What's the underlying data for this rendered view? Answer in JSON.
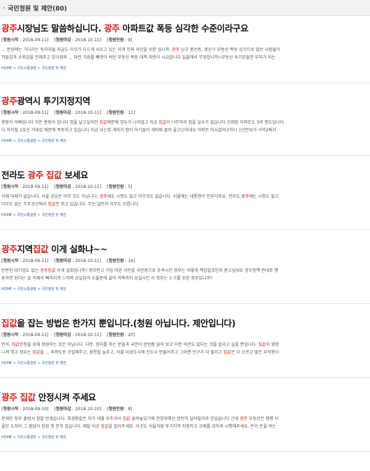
{
  "section": {
    "bullet": "·",
    "title": "국민청원 및 제안(80)"
  },
  "crumb_parts": [
    "HOME",
    "국민소통광장",
    "국민청원 및 제안"
  ],
  "posts": [
    {
      "title_parts": [
        {
          "t": "광주",
          "hl": true
        },
        {
          "t": "시장님도 말씀하십니다. ",
          "hl": false
        },
        {
          "t": "광주",
          "hl": true
        },
        {
          "t": " 아파트값 폭등 심각한 수준이라구요",
          "hl": false
        }
      ],
      "start_label": "청원시작",
      "start_date": "2018-09-11",
      "end_label": "청원마감",
      "end_date": "2018-10-11",
      "count_label": "청원인원",
      "count": "9",
      "lines": [
        [
          {
            "t": "... 문장에는 기다리는 투자자들 지금도 아무가 다드게 사오고 있는 이게 진짜 서민을 위한 입니까. ",
            "hl": false
          },
          {
            "t": "광주",
            "hl": true
          },
          {
            "t": " 남구 봉선동, 광산구 부동산 폭등 심각으로 많은 사람들이",
            "hl": false
          }
        ],
        [
          {
            "t": "허탈감과 소외감을 언제주고 양극화와 ... 마련 기회를 빼앗아 버린 부동산 폭등 대책 마련이 시급합니다 일을해서 무엇합니까!!부동산 투기꾼들만 부자가 되는",
            "hl": false
          }
        ]
      ]
    },
    {
      "title_parts": [
        {
          "t": "광주",
          "hl": true
        },
        {
          "t": "광역시 투기지정지역",
          "hl": false
        }
      ],
      "start_label": "청원시작",
      "start_date": "2018-09-11",
      "end_label": "청원마감",
      "end_date": "2018-10-11",
      "count_label": "청원인원",
      "count": "11",
      "lines": [
        [
          {
            "t": "봉동이 아빠입니다 이돈 봉동이 입니다 땅을 날고싶지만 ",
            "hl": false
          },
          {
            "t": "집값",
            "hl": true
          },
          {
            "t": "때문에 엄두가 나지않고 지금 ",
            "hl": false
          },
          {
            "t": "집값",
            "hl": true
          },
          {
            "t": "이 너무하여 집을 살수가 없습니다 오래된 아파트도 3억 평도입니다",
            "hl": false
          }
        ],
        [
          {
            "t": "다 지하철 2호선 기대감 때문에 폭등하고 있습니다 지금 사는집 개미가 땀아 아기들이 개미에 몰려 울고난리네요 아파트 이사갈려고하니 1년전보가 거의2배가",
            "hl": false
          }
        ]
      ]
    },
    {
      "title_parts": [
        {
          "t": "전라도 ",
          "hl": false
        },
        {
          "t": "광주 집값",
          "hl": true
        },
        {
          "t": " 보세요",
          "hl": false
        }
      ],
      "start_label": "청원시작",
      "start_date": "2018-09-11",
      "end_label": "청원마감",
      "end_date": "2018-10-11",
      "count_label": "청원인원",
      "count": "5",
      "lines": [
        [
          {
            "t": "이제 미래가 없습니다. 서울 강남은 아무 것도 아닙니다. ",
            "hl": false
          },
          {
            "t": "광주",
            "hl": true
          },
          {
            "t": "에도 시청도 없고 아무것도 없습니다. 서울에는 대통령이 안부이지요. 전라도 ",
            "hl": false
          },
          {
            "t": "광주",
            "hl": true
          },
          {
            "t": "에는 시청도 없고",
            "hl": false
          }
        ],
        [
          {
            "t": "아무도 없는 무주공산에서 ",
            "hl": false
          },
          {
            "t": "집값",
            "hl": true
          },
          {
            "t": "만 뛰고 있습니다. 무슨 일인지 아무도 모릅니다.",
            "hl": false
          }
        ]
      ]
    },
    {
      "title_parts": [
        {
          "t": "광주",
          "hl": true
        },
        {
          "t": "지역",
          "hl": false
        },
        {
          "t": "집값",
          "hl": true
        },
        {
          "t": " 이게 실화냐~~",
          "hl": false
        }
      ],
      "start_label": "청원시작",
      "start_date": "2018-09-11",
      "end_label": "청원마감",
      "end_date": "2018-10-11",
      "count_label": "청원인원",
      "count": "14",
      "lines": [
        [
          {
            "t": "반반한 대기업도 없는 ",
            "hl": false
          },
          {
            "t": "광주집값",
            "hl": true
          },
          {
            "t": " 이게 실화입니까? 정부번고 구입 미흔 서민을 국민층으로 추격시킨 정부는 어떻게 책임질것인지 묻고싶네요 정부정책 반대로 행",
            "hl": false
          }
        ],
        [
          {
            "t": "동하면 된다는 걸 이제야 뼈저리게 느끼며 상실감과 우울증에 삶의 의욕까지 상실시킨 이 정부는 누구를 위한 정부입니까?",
            "hl": false
          }
        ]
      ]
    },
    {
      "title_parts": [
        {
          "t": "집값",
          "hl": true
        },
        {
          "t": "을 잡는 방법은 한가지 뿐입니다.(청원 아닙니다. 제안입니다)",
          "hl": false
        }
      ],
      "start_label": "청원시작",
      "start_date": "2018-09-11",
      "end_label": "청원마감",
      "end_date": "2018-10-11",
      "count_label": "청원인원",
      "count": "20",
      "lines": [
        [
          {
            "t": "먼저, ",
            "hl": false
          },
          {
            "t": "집값",
            "hl": true
          },
          {
            "t": "안정을 위해 청원하는 것은 아닙니다. 다만, 정치를 하는 분들과 국민이 한번쯤 읽어 보고 이런 의견도 있다는 것을 알리고 싶을 뿐입니다. ",
            "hl": false
          },
          {
            "t": "집값",
            "hl": true
          },
          {
            "t": "의 영향",
            "hl": false
          }
        ],
        [
          {
            "t": "니게 뛰고 정부는 ",
            "hl": false
          },
          {
            "t": "집값",
            "hl": true
          },
          {
            "t": "을 ... 외곽도로 건설해주고, 광천철 늘추고, 서울 위성도시에 신도시 만들어주고 그러면 인구가 더 몰리고 ",
            "hl": false
          },
          {
            "t": "집값",
            "hl": true
          },
          {
            "t": "은 더 오르고 많은 부작용이",
            "hl": false
          }
        ]
      ]
    },
    {
      "title_parts": [
        {
          "t": "광주 집값",
          "hl": true
        },
        {
          "t": " 안정시켜 주세요",
          "hl": false
        }
      ],
      "start_label": "청원시작",
      "start_date": "2018-09-10",
      "end_label": "청원마감",
      "end_date": "2018-10-10",
      "count_label": "청원인원",
      "count": "8",
      "lines": [
        [
          {
            "t": "문재인 정부 출범시 정말 반겼습니다. 최경환같은 자가 대출 부추겨서 ",
            "hl": false
          },
          {
            "t": "집값",
            "hl": true
          },
          {
            "t": " 올려놓았기에 문정부에선 완전히 달라질거라 믿었습니다 근데 ",
            "hl": false
          },
          {
            "t": "광주",
            "hl": true
          },
          {
            "t": " 부동산은 평평 터",
            "hl": false
          }
        ],
        [
          {
            "t": "을단 도저어 그 붐담이 망원 첫 문치 않습니다. 제발 이곳 ",
            "hl": false
          },
          {
            "t": "집값",
            "hl": true
          },
          {
            "t": "을 잡아주세요. 이곳도 서울처럼 투기지역 지정하고 규제를 강하게 시행해주세요. 돈이 돈을 버는",
            "hl": false
          }
        ]
      ]
    }
  ]
}
